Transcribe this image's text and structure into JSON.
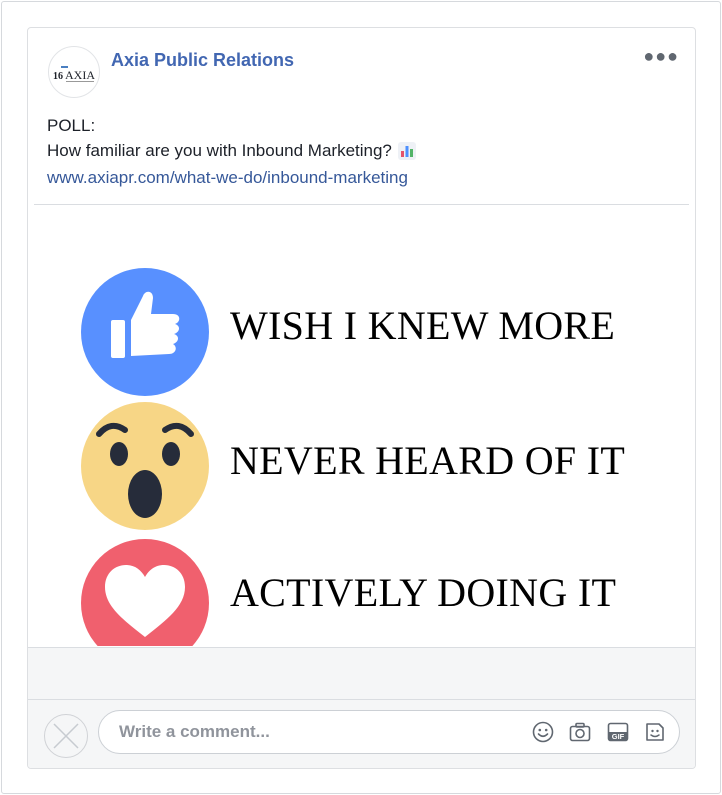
{
  "post": {
    "page_name": "Axia Public Relations",
    "avatar_logo": "16 AXIA",
    "more_icon": "ellipsis-icon",
    "text_line1": "POLL:",
    "text_line2": "How familiar are you with Inbound Marketing?",
    "emoji": "bar-chart-icon",
    "link": "www.axiapr.com/what-we-do/inbound-marketing"
  },
  "poll": {
    "options": [
      {
        "reaction": "like",
        "icon": "thumbs-up-icon",
        "label": "WISH I KNEW MORE",
        "color": "#5890ff"
      },
      {
        "reaction": "wow",
        "icon": "wow-face-icon",
        "label": "NEVER HEARD OF IT",
        "color": "#f7d686"
      },
      {
        "reaction": "love",
        "icon": "heart-icon",
        "label": "ACTIVELY DOING IT",
        "color": "#f0606e"
      }
    ]
  },
  "comment": {
    "placeholder": "Write a comment...",
    "icons": [
      "emoji-icon",
      "camera-icon",
      "gif-icon",
      "sticker-icon"
    ]
  },
  "colors": {
    "link": "#365899",
    "page_name": "#4267b2",
    "band": "#f5f6f7"
  }
}
